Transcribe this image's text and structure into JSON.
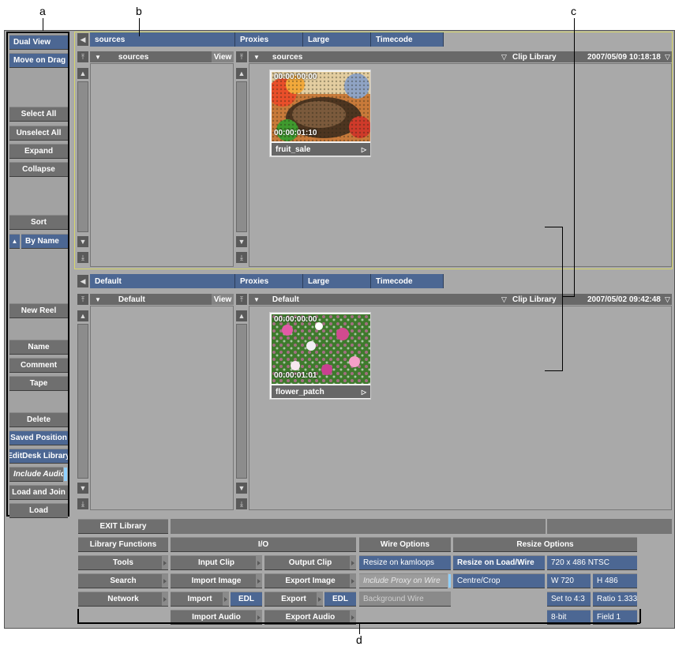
{
  "callouts": {
    "a": "a",
    "b": "b",
    "c": "c",
    "d": "d"
  },
  "sidebar": {
    "dual_view": "Dual View",
    "move_on_drag": "Move on Drag",
    "select_all": "Select All",
    "unselect_all": "Unselect All",
    "expand": "Expand",
    "collapse": "Collapse",
    "sort": "Sort",
    "by_name": "By Name",
    "new_reel": "New Reel",
    "name": "Name",
    "comment": "Comment",
    "tape": "Tape",
    "delete": "Delete",
    "saved_position": "Saved Position",
    "editdesk_library": "EditDesk Library",
    "include_audio": "Include Audio",
    "load_and_join": "Load and Join",
    "load": "Load"
  },
  "top_library": {
    "name": "sources",
    "proxies": "Proxies",
    "large": "Large",
    "timecode": "Timecode",
    "tree_title": "sources",
    "view": "View",
    "clip_path": "sources",
    "clip_library": "Clip Library",
    "datetime": "2007/05/09 10:18:18",
    "clip_name": "fruit_sale",
    "clip_tc_start": "00:00:00:00",
    "clip_tc_end": "00:00:01:10"
  },
  "bottom_library": {
    "name": "Default",
    "proxies": "Proxies",
    "large": "Large",
    "timecode": "Timecode",
    "tree_title": "Default",
    "view": "View",
    "clip_path": "Default",
    "clip_library": "Clip Library",
    "datetime": "2007/05/02 09:42:48",
    "clip_name": "flower_patch",
    "clip_tc_start": "00:00:00:00",
    "clip_tc_end": "00:00:01:01"
  },
  "bottom": {
    "exit_library": "EXIT Library",
    "library_functions": "Library Functions",
    "io": "I/O",
    "wire_options": "Wire Options",
    "resize_options": "Resize Options",
    "tools": "Tools",
    "search": "Search",
    "network": "Network",
    "input_clip": "Input Clip",
    "output_clip": "Output Clip",
    "import_image": "Import Image",
    "export_image": "Export Image",
    "import": "Import",
    "export": "Export",
    "edl_in": "EDL",
    "edl_out": "EDL",
    "import_audio": "Import Audio",
    "export_audio": "Export Audio",
    "resize_on_kamloops": "Resize on kamloops",
    "include_proxy_on_wire": "Include Proxy on Wire",
    "background_wire": "Background Wire",
    "resize_on_load_wire": "Resize on Load/Wire",
    "centre_crop": "Centre/Crop",
    "format": "720 x 486 NTSC",
    "width": "W 720",
    "height": "H 486",
    "set_to": "Set to 4:3",
    "ratio": "Ratio 1.333",
    "bit": "8-bit",
    "field": "Field 1"
  },
  "colors": {
    "accent_blue": "#4c6793",
    "panel_gray": "#a9a9a9",
    "button_gray": "#6f6f6f",
    "highlight": "#8fd0ff"
  }
}
